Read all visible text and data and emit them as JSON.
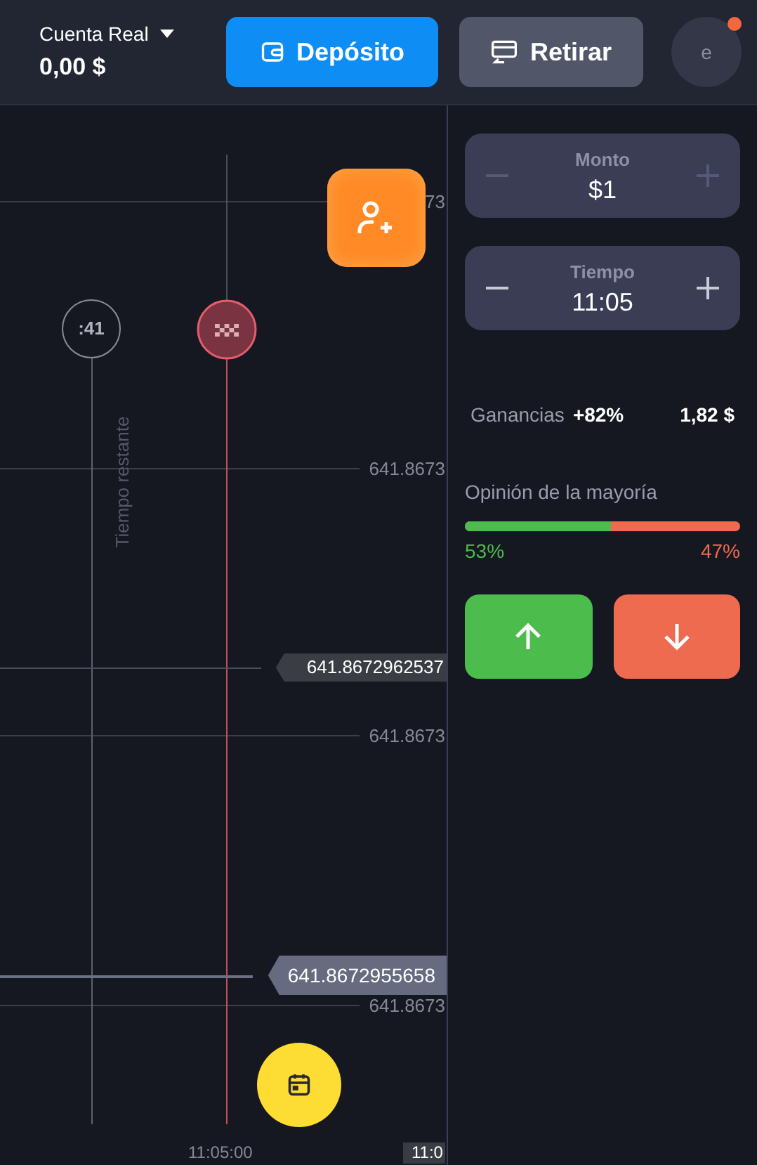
{
  "header": {
    "account": {
      "label": "Cuenta Real",
      "balance": "0,00 $"
    },
    "buttons": [
      {
        "kind": "deposit",
        "label": "Depósito"
      },
      {
        "kind": "withdraw",
        "label": "Retirar"
      }
    ],
    "avatar": {
      "initial": "e",
      "notification": true
    }
  },
  "chart": {
    "grid_labels": [
      "73",
      "641.8673",
      "641.8673",
      "641.8673"
    ],
    "price_tags": [
      {
        "kind": "past",
        "value": "641.8672962537"
      },
      {
        "kind": "current",
        "value": "641.8672955658"
      }
    ],
    "timer": ":41",
    "timer_caption": "Tiempo restante",
    "time_labels": [
      {
        "kind": "axis",
        "text": "11:05:00"
      },
      {
        "kind": "tag",
        "text": "11:0"
      }
    ]
  },
  "trade_panel": {
    "steppers": [
      {
        "label": "Monto",
        "value": "$1",
        "disabled": true
      },
      {
        "label": "Tiempo",
        "value": "11:05",
        "disabled": false
      }
    ],
    "payout": {
      "label": "Ganancias",
      "percent": "+82%",
      "amount": "1,82 $"
    },
    "sentiment": {
      "title": "Opinión de la mayoría",
      "level": 0.53,
      "up": "53%",
      "down": "47%"
    },
    "trade_buttons": [
      {
        "kind": "up"
      },
      {
        "kind": "down"
      }
    ]
  }
}
